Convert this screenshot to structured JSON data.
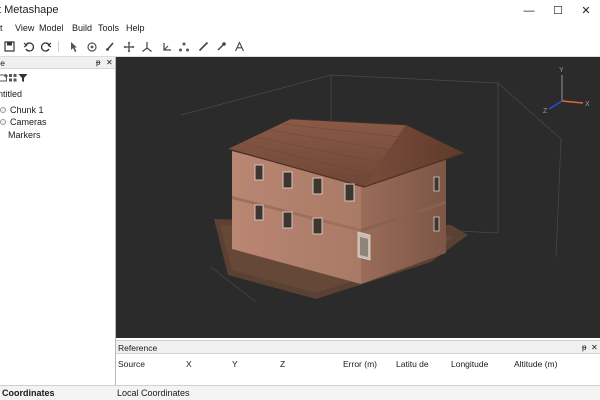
{
  "window": {
    "title": "t Metashape",
    "controls": {
      "minimize": "—",
      "maximize": "☐",
      "close": "✕"
    }
  },
  "menu": [
    "it",
    "View",
    "Model",
    "Build",
    "Tools",
    "Help"
  ],
  "toolbar": {
    "icons": [
      "save-icon",
      "undo-icon",
      "redo-icon",
      "navigate-icon",
      "rotate-object-icon",
      "brush-icon",
      "move-icon",
      "axis-icon",
      "rotate-axis-icon",
      "region-icon",
      "ruler-icon",
      "picker-icon",
      "text-icon"
    ]
  },
  "workspace": {
    "header_label": "ce",
    "pin": "ᵽ",
    "close": "✕",
    "tree": [
      {
        "label": "ntitled"
      },
      {
        "label": "Chunk 1"
      },
      {
        "label": "Cameras"
      },
      {
        "label": "Markers"
      }
    ]
  },
  "viewport": {
    "background": "#2b2b2b",
    "axis_labels": {
      "x": "X",
      "y": "Y",
      "z": "Z"
    },
    "axis_colors": {
      "x": "#e06a2c",
      "y": "#7a7a7a",
      "z": "#2a4fd8"
    }
  },
  "reference": {
    "title": "Reference",
    "pin": "ᵽ",
    "close": "✕",
    "columns": [
      "Source",
      "X",
      "Y",
      "Z",
      "Error (m)",
      "Latitu de",
      "Longitude",
      "Altitude (m)"
    ]
  },
  "bottom_tabs": [
    "Coordinates",
    "Local Coordinates"
  ]
}
